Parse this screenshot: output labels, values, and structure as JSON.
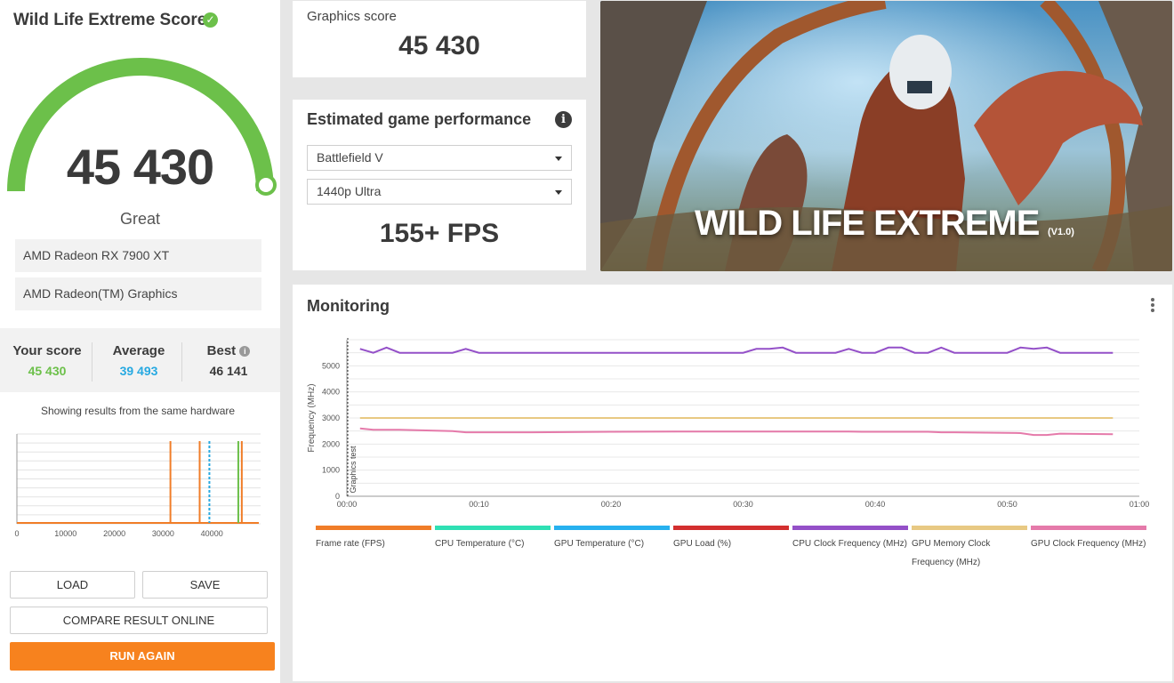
{
  "left_panel": {
    "title": "Wild Life Extreme Score",
    "score": "45 430",
    "rating": "Great",
    "hardware": [
      "AMD Radeon RX 7900 XT",
      "AMD Radeon(TM) Graphics"
    ],
    "your_score_label": "Your score",
    "your_score": "45 430",
    "average_label": "Average",
    "average": "39 493",
    "best_label": "Best",
    "best": "46 141",
    "same_hw_text": "Showing results from the same hardware",
    "histogram_x_ticks": [
      "0",
      "10000",
      "20000",
      "30000",
      "40000"
    ],
    "buttons": {
      "load": "LOAD",
      "save": "SAVE",
      "compare": "COMPARE RESULT ONLINE",
      "run": "RUN AGAIN"
    }
  },
  "graphics_score": {
    "label": "Graphics score",
    "value": "45 430"
  },
  "estimated_performance": {
    "title": "Estimated game performance",
    "game": "Battlefield V",
    "resolution": "1440p Ultra",
    "fps": "155+ FPS"
  },
  "banner": {
    "title": "WILD LIFE EXTREME",
    "version": "(V1.0)"
  },
  "monitoring": {
    "title": "Monitoring",
    "legend": [
      {
        "label": "Frame rate (FPS)",
        "color": "#f07d28"
      },
      {
        "label": "CPU Temperature (°C)",
        "color": "#2fe0b4"
      },
      {
        "label": "GPU Temperature (°C)",
        "color": "#27b1ef"
      },
      {
        "label": "GPU Load (%)",
        "color": "#d32f2f"
      },
      {
        "label": "CPU Clock Frequency (MHz)",
        "color": "#9450c8"
      },
      {
        "label": "GPU Memory Clock Frequency (MHz)",
        "color": "#e8c983"
      },
      {
        "label": "GPU Clock Frequency (MHz)",
        "color": "#e57aaa"
      }
    ]
  },
  "colors": {
    "accent_green": "#6cc04a",
    "average_blue": "#27a9e1",
    "run_orange": "#f7821e"
  },
  "chart_data": {
    "type": "line",
    "title": "",
    "xlabel": "",
    "ylabel": "Frequency (MHz)",
    "annotation": "Graphics test",
    "x_ticks": [
      "00:00",
      "00:10",
      "00:20",
      "00:30",
      "00:40",
      "00:50",
      "01:00"
    ],
    "y_ticks": [
      "0",
      "1000",
      "2000",
      "3000",
      "4000",
      "5000"
    ],
    "ylim": [
      0,
      6000
    ],
    "xlim": [
      0,
      60
    ],
    "x": [
      1,
      2,
      3,
      4,
      8,
      9,
      10,
      14,
      20,
      25,
      29,
      30,
      31,
      32,
      33,
      34,
      37,
      38,
      39,
      40,
      41,
      42,
      43,
      44,
      45,
      46,
      50,
      51,
      52,
      53,
      54,
      58
    ],
    "series": [
      {
        "name": "CPU Clock Frequency (MHz)",
        "color": "#9450c8",
        "values": [
          5650,
          5500,
          5700,
          5500,
          5500,
          5650,
          5500,
          5500,
          5500,
          5500,
          5500,
          5500,
          5650,
          5650,
          5700,
          5500,
          5500,
          5650,
          5500,
          5500,
          5700,
          5700,
          5500,
          5500,
          5700,
          5500,
          5500,
          5700,
          5650,
          5700,
          5500,
          5500
        ]
      },
      {
        "name": "GPU Memory Clock Frequency (MHz)",
        "color": "#e8c983",
        "values": [
          3000,
          3000,
          3000,
          3000,
          3000,
          3000,
          3000,
          3000,
          3000,
          3000,
          3000,
          3000,
          3000,
          3000,
          3000,
          3000,
          3000,
          3000,
          3000,
          3000,
          3000,
          3000,
          3000,
          3000,
          3000,
          3000,
          3000,
          3000,
          3000,
          3000,
          3000,
          3000
        ]
      },
      {
        "name": "GPU Clock Frequency (MHz)",
        "color": "#e57aaa",
        "values": [
          2600,
          2550,
          2550,
          2550,
          2500,
          2450,
          2450,
          2450,
          2470,
          2480,
          2480,
          2480,
          2480,
          2480,
          2480,
          2480,
          2480,
          2480,
          2470,
          2470,
          2470,
          2470,
          2470,
          2470,
          2450,
          2450,
          2430,
          2420,
          2350,
          2350,
          2400,
          2380
        ]
      }
    ]
  },
  "histogram_data": {
    "xlim": [
      0,
      50000
    ],
    "spikes": [
      {
        "x": 31500,
        "color": "#f07d28"
      },
      {
        "x": 37500,
        "color": "#f07d28"
      },
      {
        "x": 39493,
        "color": "#27a9e1",
        "dashed": true
      },
      {
        "x": 45430,
        "color": "#6cc04a"
      },
      {
        "x": 46141,
        "color": "#f07d28"
      }
    ]
  }
}
